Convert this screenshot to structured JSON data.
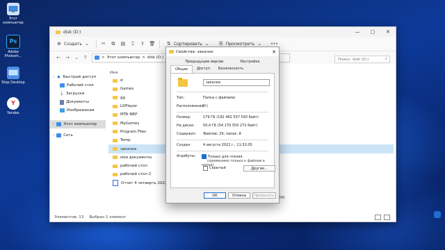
{
  "desktop": {
    "icons": [
      {
        "label": "Этот компьютер",
        "color": "#cfe3ff"
      },
      {
        "label": "Adobe Photosh...",
        "color": "#0b1e3a"
      },
      {
        "label": "Stop Desktop",
        "color": "#4f8fe8"
      },
      {
        "label": "Yandex",
        "color": "#ffffff"
      }
    ],
    "photoshop_glyph": "Ps",
    "yandex_glyph": "Y"
  },
  "explorer": {
    "title": "disk (D:)",
    "toolbar": {
      "new": "Создать",
      "sort": "Сортировать",
      "view": "Просмотреть",
      "more": "•••"
    },
    "address": {
      "segments": [
        "Этот компьютер",
        "disk (D:)"
      ],
      "sep": ">"
    },
    "search_placeholder": "Поиск: disk (D:)",
    "column_name": "Имя",
    "sidebar": [
      {
        "label": "Быстрый доступ",
        "icon": "star",
        "indent": 0
      },
      {
        "label": "Рабочий стол",
        "icon": "blue",
        "indent": 1
      },
      {
        "label": "Загрузки",
        "icon": "download",
        "indent": 1
      },
      {
        "label": "Документы",
        "icon": "doc",
        "indent": 1
      },
      {
        "label": "Изображения",
        "icon": "image",
        "indent": 1
      },
      {
        "label": "Этот компьютер",
        "icon": "pc",
        "indent": 0,
        "selected": true
      },
      {
        "label": "Сеть",
        "icon": "net",
        "indent": 0
      }
    ],
    "files": [
      {
        "name": "d"
      },
      {
        "name": "Games"
      },
      {
        "name": "gg"
      },
      {
        "name": "LDPlayer"
      },
      {
        "name": "MTA NRP"
      },
      {
        "name": "MyGames"
      },
      {
        "name": "Program Files"
      },
      {
        "name": "Temp"
      },
      {
        "name": "закачки",
        "selected": true
      },
      {
        "name": "мои документы"
      },
      {
        "name": "рабочий стол"
      },
      {
        "name": "рабочий стол 2"
      },
      {
        "name": "Отчет 4 четверть 2022"
      }
    ],
    "status": {
      "count": "Элементов: 13",
      "selected": "Выбран 1 элемент"
    },
    "size_fragment": "КБ"
  },
  "dialog": {
    "title": "Свойства: закачки",
    "tabs_top": [
      "Предыдущие версии",
      "Настройка"
    ],
    "tabs_bottom": [
      "Общие",
      "Доступ",
      "Безопасность"
    ],
    "active_tab": "Общие",
    "name": "закачки",
    "type_label": "Тип:",
    "type_value": "Папка с файлами",
    "location_label": "Расположение:",
    "location_value": "D:\\",
    "size_label": "Размер:",
    "size_value": "179 ГБ (192 462 557 593 байт)",
    "disk_label": "На диске:",
    "disk_value": "50,4 ГБ (54 170 550 272 байт)",
    "contains_label": "Содержит:",
    "contains_value": "Файлов: 29; папок: 8",
    "created_label": "Создан:",
    "created_value": "4 августа 2022 г., 11:52:05",
    "attributes_label": "Атрибуты:",
    "readonly_label": "Только для чтения",
    "readonly_sub": "(применимо только к файлам в папке)",
    "hidden_label": "Скрытый",
    "other_button": "Другие...",
    "ok": "ОК",
    "cancel": "Отмена",
    "apply": "Применить"
  }
}
